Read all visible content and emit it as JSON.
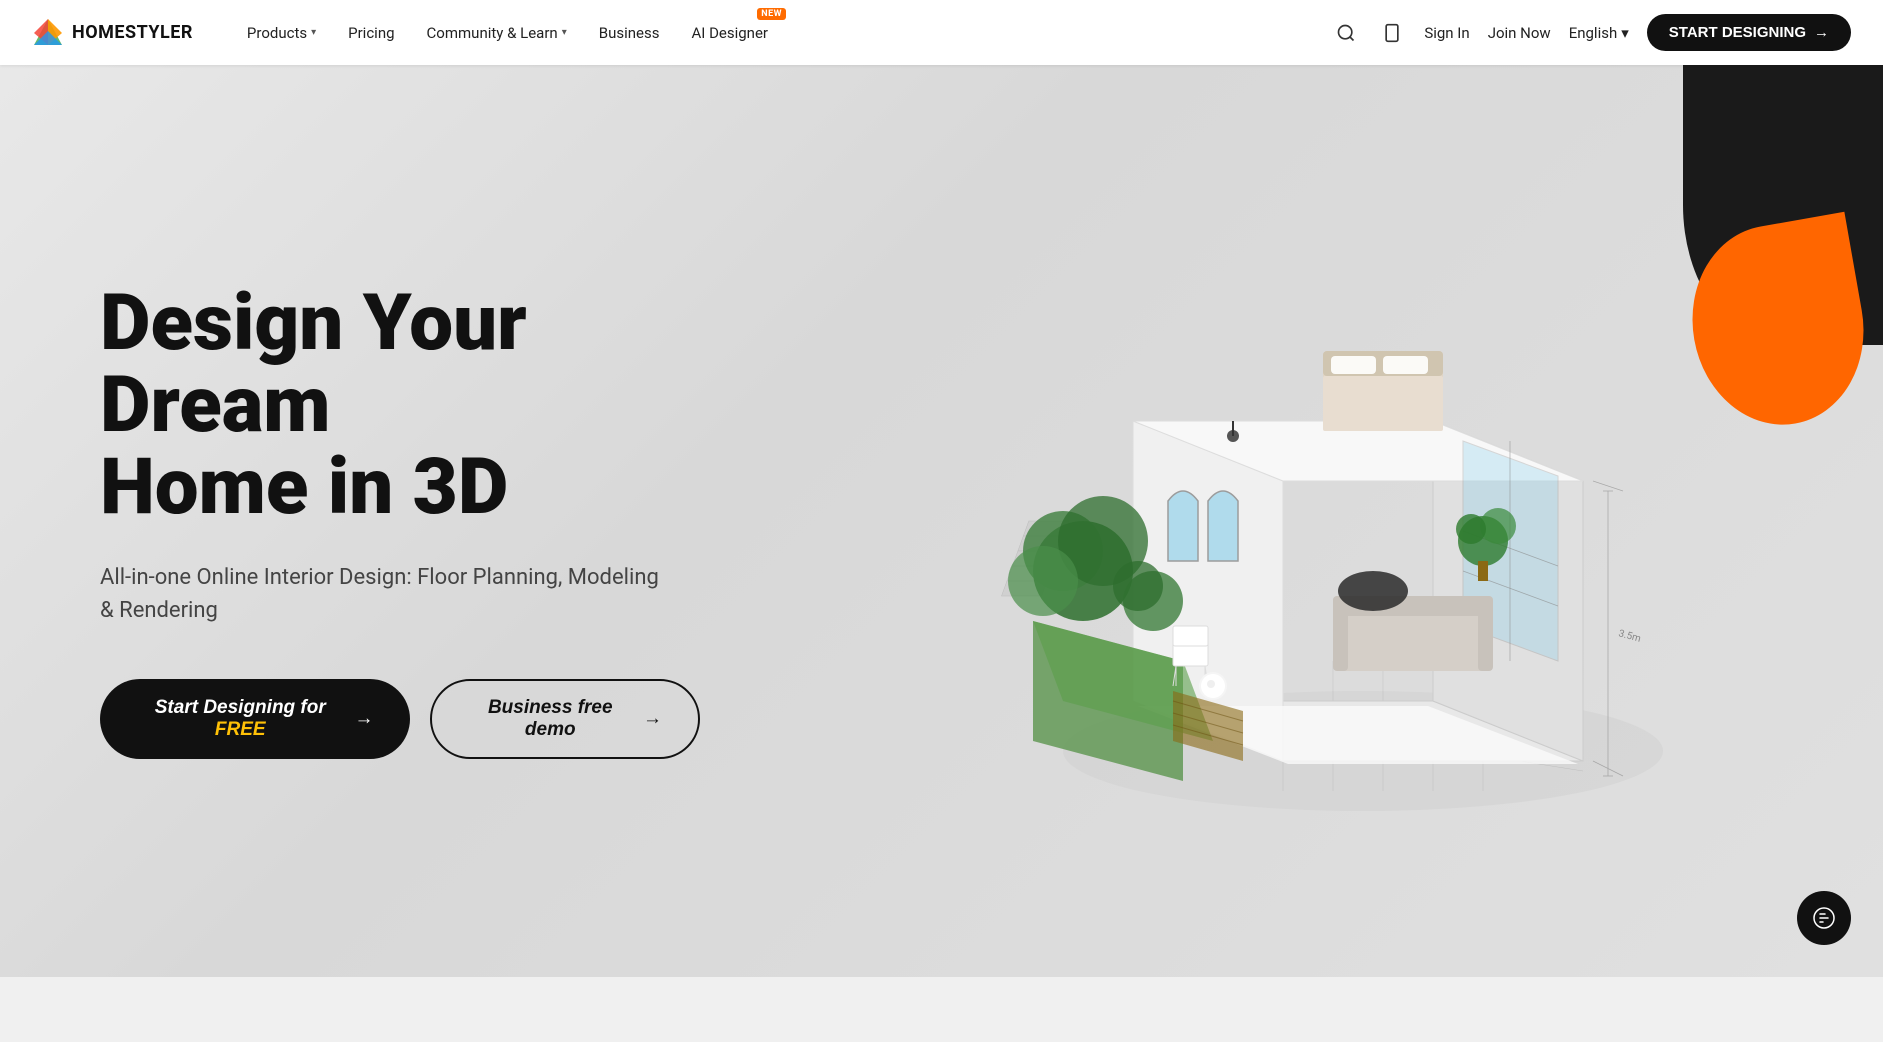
{
  "nav": {
    "logo_text": "HOMESTYLER",
    "links": [
      {
        "label": "Products",
        "has_dropdown": true,
        "id": "products"
      },
      {
        "label": "Pricing",
        "has_dropdown": false,
        "id": "pricing"
      },
      {
        "label": "Community & Learn",
        "has_dropdown": true,
        "id": "community"
      },
      {
        "label": "Business",
        "has_dropdown": false,
        "id": "business"
      },
      {
        "label": "AI Designer",
        "has_dropdown": false,
        "id": "ai-designer",
        "badge": "NEW"
      }
    ],
    "sign_in": "Sign In",
    "join_now": "Join Now",
    "language": "English",
    "start_btn": "START DESIGNING"
  },
  "hero": {
    "title_line1": "Design Your Dream",
    "title_line2": "Home in 3D",
    "subtitle": "All-in-one Online Interior Design: Floor Planning, Modeling & Rendering",
    "btn_primary_prefix": "Start Designing for ",
    "btn_primary_free": "FREE",
    "btn_primary_arrow": "→",
    "btn_secondary": "Business free demo",
    "btn_secondary_arrow": "→"
  },
  "colors": {
    "accent_orange": "#ff6600",
    "accent_yellow": "#ffc107",
    "dark": "#111111",
    "nav_bg": "#ffffff"
  }
}
